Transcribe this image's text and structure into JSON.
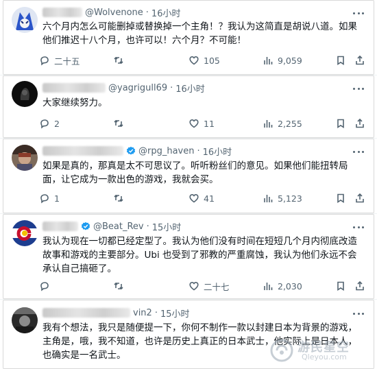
{
  "tweets": [
    {
      "handle": "@Wolvenone",
      "time": "16小时",
      "text": "六个月内怎么可能删掉或替换掉一个主角！？我认为这简直是胡说八道。如果他们推迟十八个月，也许可以！六个月？不可能！",
      "verified": false,
      "stats": {
        "reply": "二十五",
        "retweet": "",
        "like": "105",
        "views": "9,059"
      }
    },
    {
      "handle": "@yagrigull69",
      "time": "16小时",
      "text": "大家继续努力。",
      "verified": false,
      "stats": {
        "reply": "2",
        "retweet": "",
        "like": "11",
        "views": "2,255"
      }
    },
    {
      "handle": "@rpg_haven",
      "time": "16小时",
      "text": "如果是真的，那真是太不可思议了。听听粉丝们的意见。如果他们能扭转局面，让它成为一款出色的游戏，我就会买。",
      "verified": true,
      "stats": {
        "reply": "1",
        "retweet": "",
        "like": "41",
        "views": "5,123"
      }
    },
    {
      "handle": "@Beat_Rev",
      "time": "15小时",
      "text": "我认为现在一切都已经定型了。我认为他们没有时间在短短几个月内彻底改造故事和游戏的主要部分。Ubi 也受到了邪教的严重腐蚀，我认为他们永远不会承认自己搞砸了。",
      "verified": true,
      "stats": {
        "reply": "",
        "retweet": "",
        "like": "二十七",
        "views": "2,030"
      }
    },
    {
      "handle": "vin2",
      "time": "15小时",
      "text": "我有个想法，我只是随便提一下，你何不制作一款以封建日本为背景的游戏，主角是，哦，我不知道，也许是历史上真正的日本武士，他实际上是日本人，也确实是一名武士。",
      "verified": false,
      "stats": null
    }
  ],
  "watermark": {
    "text": "游民星空",
    "sub": "Qleyou.com"
  },
  "colors": {
    "text": "#0f1419",
    "muted": "#536471",
    "verified": "#1d9bf0",
    "divider": "#eff3f4"
  }
}
